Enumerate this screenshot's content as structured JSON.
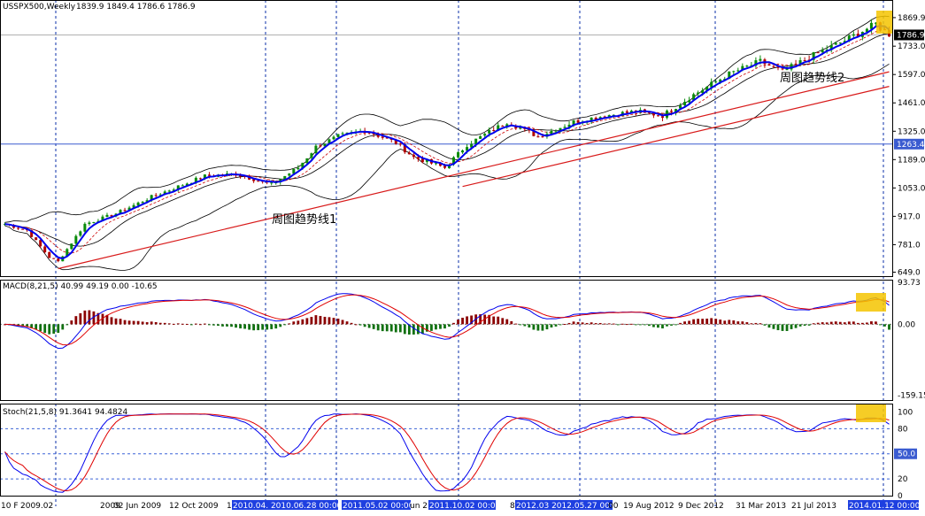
{
  "header": {
    "symbol_text": "USSPX500,Weekly",
    "ohlc_text": "1839.9 1849.4 1786.6 1786.9"
  },
  "price_axis": {
    "ticks": [
      "1869.9",
      "1733.0",
      "1597.0",
      "1461.0",
      "1325.0",
      "1189.0",
      "1053.0",
      "917.0",
      "781.0",
      "649.0"
    ],
    "current_price_label": "1786.9",
    "hline_label": "1263.4"
  },
  "annotations": {
    "trendline_1": "周图趋势线1",
    "trendline_2": "周图趋势线2"
  },
  "macd": {
    "label": "MACD(8,21,5) 40.99 49.19 0.00 -10.65",
    "ticks": [
      "93.73",
      "0.00",
      "-159.15"
    ]
  },
  "stoch": {
    "label": "Stoch(21,5,8) 91.3641 94.4824",
    "ticks": [
      "100",
      "80",
      "50.0",
      "20",
      "0"
    ]
  },
  "time_axis": {
    "labels": [
      "10 F",
      "2009.02",
      "2009",
      "02 Jun 2009",
      "12 Oct 2009",
      "1",
      "2010.04. 2010.06.28 00:00",
      "2011.05.02 00:00",
      "un 2",
      "2011.10.02 00:00",
      "8",
      "2012.03 2012.05.27 00:00",
      "00",
      "19 Aug 2012",
      "9 Dec 2012",
      "31 Mar 2013",
      "21 Jul 2013",
      "2014.01.12 00:00"
    ]
  },
  "colors": {
    "bull": "#0a8a0a",
    "bear": "#b00000",
    "ma": "#0000ee",
    "signal": "#e00000",
    "trend": "#d81a1a",
    "highlight": "#f5c400",
    "grid": "#0b2fa8"
  },
  "chart_data": {
    "type": "candlestick",
    "title": "USSPX500,Weekly",
    "ylim": [
      630,
      1895
    ],
    "x_start": "2009-02",
    "x_end": "2014-01",
    "last_ohlc": {
      "open": 1839.9,
      "high": 1849.4,
      "low": 1786.6,
      "close": 1786.9
    },
    "horizontal_line": 1263.4,
    "anchors": [
      {
        "week": 0,
        "price": 880
      },
      {
        "week": 5,
        "price": 850
      },
      {
        "week": 10,
        "price": 720
      },
      {
        "week": 12,
        "price": 700
      },
      {
        "week": 18,
        "price": 880
      },
      {
        "week": 25,
        "price": 930
      },
      {
        "week": 33,
        "price": 1010
      },
      {
        "week": 45,
        "price": 1110
      },
      {
        "week": 52,
        "price": 1120
      },
      {
        "week": 60,
        "price": 1070
      },
      {
        "week": 66,
        "price": 1150
      },
      {
        "week": 70,
        "price": 1250
      },
      {
        "week": 75,
        "price": 1300
      },
      {
        "week": 81,
        "price": 1330
      },
      {
        "week": 88,
        "price": 1270
      },
      {
        "week": 92,
        "price": 1200
      },
      {
        "week": 99,
        "price": 1150
      },
      {
        "week": 104,
        "price": 1260
      },
      {
        "week": 113,
        "price": 1370
      },
      {
        "week": 120,
        "price": 1300
      },
      {
        "week": 128,
        "price": 1370
      },
      {
        "week": 135,
        "price": 1400
      },
      {
        "week": 142,
        "price": 1420
      },
      {
        "week": 148,
        "price": 1400
      },
      {
        "week": 155,
        "price": 1500
      },
      {
        "week": 163,
        "price": 1600
      },
      {
        "week": 170,
        "price": 1660
      },
      {
        "week": 175,
        "price": 1610
      },
      {
        "week": 182,
        "price": 1690
      },
      {
        "week": 189,
        "price": 1760
      },
      {
        "week": 196,
        "price": 1840
      },
      {
        "week": 199,
        "price": 1790
      }
    ],
    "trendlines": [
      {
        "name": "周图趋势线1",
        "from": {
          "week": 12,
          "price": 666
        },
        "to": {
          "week": 199,
          "price": 1610
        }
      },
      {
        "name": "周图趋势线2",
        "from": {
          "week": 103,
          "price": 1060
        },
        "to": {
          "week": 199,
          "price": 1540
        }
      }
    ],
    "macd": {
      "ylim": [
        -170,
        100
      ],
      "fast": 8,
      "slow": 21,
      "signal": 5,
      "macd_value": 40.99,
      "signal_value": 49.19
    },
    "stoch": {
      "ylim": [
        0,
        110
      ],
      "k_period": 21,
      "d_period": 5,
      "slowing": 8,
      "k_value": 91.3641,
      "d_value": 94.4824,
      "levels": [
        20,
        50,
        80
      ]
    }
  }
}
